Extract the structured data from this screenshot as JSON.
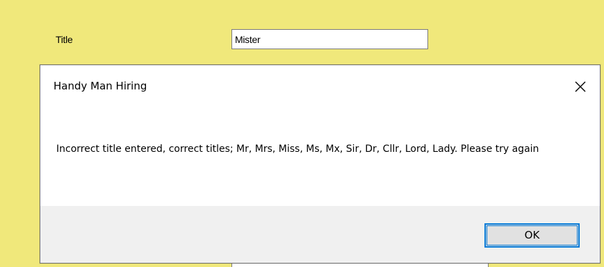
{
  "form": {
    "title_label": "Title",
    "title_value": "Mister"
  },
  "dialog": {
    "title": "Handy Man Hiring",
    "message": "Incorrect title entered, correct titles; Mr, Mrs, Miss, Ms, Mx, Sir, Dr, Cllr, Lord, Lady. Please try again",
    "ok_label": "OK",
    "close_icon": "close-icon"
  },
  "colors": {
    "form_background": "#f0e87b",
    "dialog_footer": "#f0f0f0",
    "button_face": "#e1e1e1",
    "focus_border": "#0078d7"
  }
}
